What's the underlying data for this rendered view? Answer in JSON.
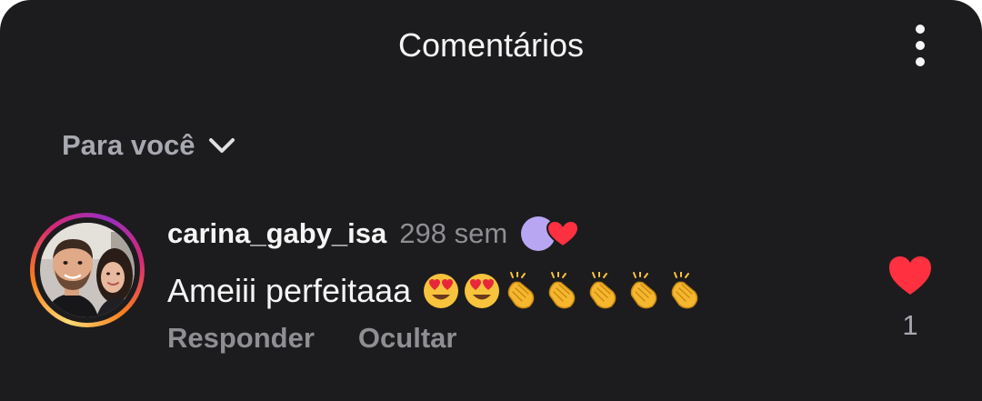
{
  "header": {
    "title": "Comentários",
    "menu_icon": "more-vertical-icon"
  },
  "sort": {
    "label": "Para você",
    "icon": "chevron-down-icon"
  },
  "comment": {
    "username": "carina_gaby_isa",
    "timestamp": "298 sem",
    "text": "Ameiii perfeitaaa",
    "emojis": [
      "heart-eyes",
      "heart-eyes",
      "clapping-hands",
      "clapping-hands",
      "clapping-hands",
      "clapping-hands",
      "clapping-hands"
    ],
    "reaction_badge_icon": "liked-by-creator-icon",
    "actions": {
      "reply_label": "Responder",
      "hide_label": "Ocultar"
    },
    "like_icon": "heart-filled-icon",
    "like_count": "1",
    "like_color": "#ff3040"
  },
  "colors": {
    "background": "#1c1c1e",
    "primary_text": "#f5f5f5",
    "secondary_text": "#8e8e93",
    "heart": "#ff3040",
    "badge_circle": "#b9a6f2"
  }
}
